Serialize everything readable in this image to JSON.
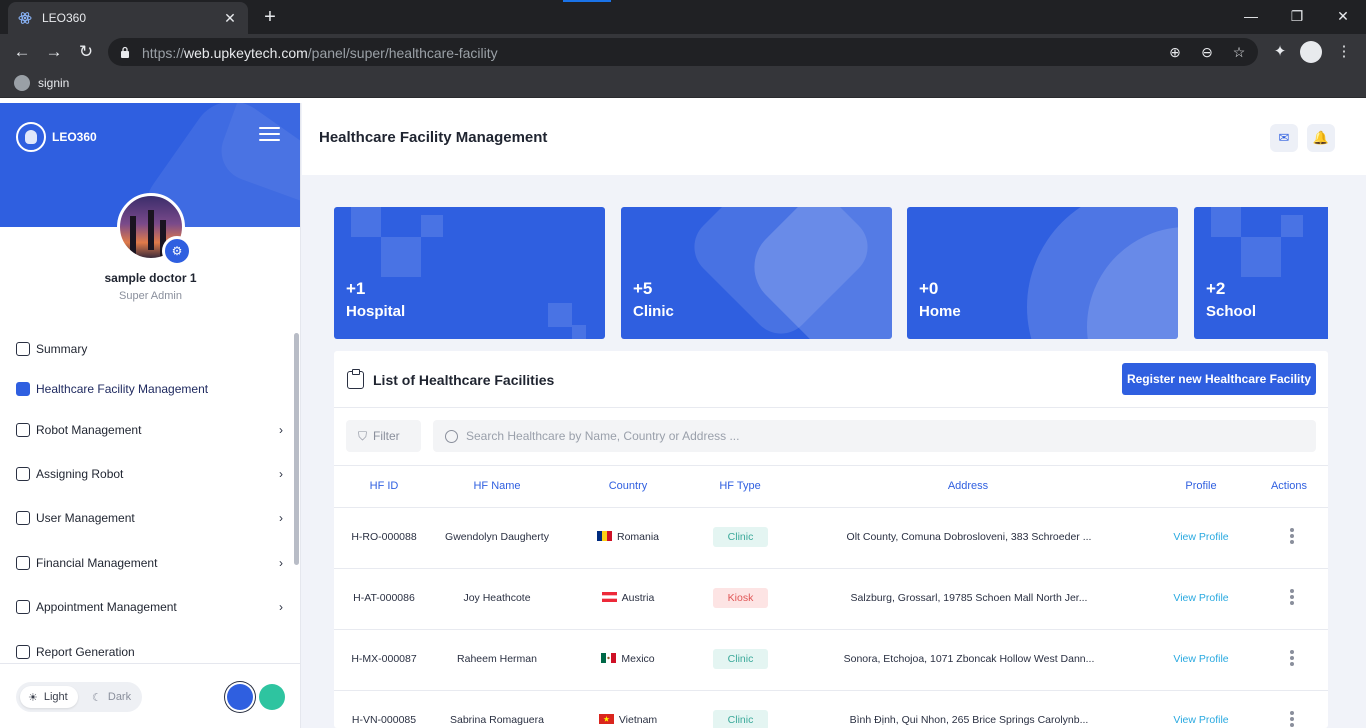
{
  "browser": {
    "tab_title": "LEO360",
    "tab_close": "✕",
    "new_tab": "+",
    "url_scheme": "https://",
    "url_host": "web.upkeytech.com",
    "url_path": "/panel/super/healthcare-facility",
    "bookmark": "signin",
    "window_controls": {
      "minimize": "—",
      "restore": "❐",
      "close": "✕"
    }
  },
  "sidebar": {
    "brand": "LEO360",
    "user_name": "sample doctor 1",
    "user_role": "Super Admin",
    "menu": [
      {
        "label": "Summary",
        "icon": "summary-icon",
        "chevron": ""
      },
      {
        "label": "Healthcare Facility Management",
        "icon": "building-icon",
        "chevron": "",
        "active": true
      },
      {
        "label": "Robot Management",
        "icon": "monitor-icon",
        "chevron": "›"
      },
      {
        "label": "Assigning Robot",
        "icon": "check-square-icon",
        "chevron": "›"
      },
      {
        "label": "User Management",
        "icon": "users-icon",
        "chevron": "›"
      },
      {
        "label": "Financial Management",
        "icon": "dollar-icon",
        "chevron": "›"
      },
      {
        "label": "Appointment Management",
        "icon": "calendar-icon",
        "chevron": "›"
      },
      {
        "label": "Report Generation",
        "icon": "chart-icon",
        "chevron": ""
      }
    ],
    "theme": {
      "light": "Light",
      "dark": "Dark",
      "light_glyph": "☀",
      "dark_glyph": "☾"
    },
    "accent_colors": [
      "#2f5fe0",
      "#2ec4a0"
    ]
  },
  "header": {
    "title": "Healthcare Facility Management",
    "chat_glyph": "✉",
    "bell_glyph": "🔔"
  },
  "cards": [
    {
      "count": "+1",
      "label": "Hospital"
    },
    {
      "count": "+5",
      "label": "Clinic"
    },
    {
      "count": "+0",
      "label": "Home"
    },
    {
      "count": "+2",
      "label": "School"
    }
  ],
  "list": {
    "title": "List of Healthcare Facilities",
    "register_button": "Register new Healthcare Facility",
    "filter_label": "Filter",
    "search_placeholder": "Search Healthcare by Name, Country or Address ...",
    "columns": [
      "HF ID",
      "HF Name",
      "Country",
      "HF Type",
      "Address",
      "Profile",
      "Actions"
    ],
    "rows": [
      {
        "id": "H-RO-000088",
        "name": "Gwendolyn Daugherty",
        "country": "Romania",
        "type": "Clinic",
        "address": "Olt County, Comuna Dobrosloveni, 383 Schroeder ...",
        "profile": "View Profile"
      },
      {
        "id": "H-AT-000086",
        "name": "Joy Heathcote",
        "country": "Austria",
        "type": "Kiosk",
        "address": "Salzburg, Grossarl, 19785 Schoen Mall North Jer...",
        "profile": "View Profile"
      },
      {
        "id": "H-MX-000087",
        "name": "Raheem Herman",
        "country": "Mexico",
        "type": "Clinic",
        "address": "Sonora, Etchojoa, 1071 Zboncak Hollow West Dann...",
        "profile": "View Profile"
      },
      {
        "id": "H-VN-000085",
        "name": "Sabrina Romaguera",
        "country": "Vietnam",
        "type": "Clinic",
        "address": "Bình Định, Qui Nhon, 265 Brice Springs Carolynb...",
        "profile": "View Profile"
      }
    ]
  },
  "colors": {
    "primary": "#2f5fe0",
    "link": "#29a9e0",
    "clinic_bg": "#e4f5f2",
    "kiosk_bg": "#fde4e4"
  }
}
